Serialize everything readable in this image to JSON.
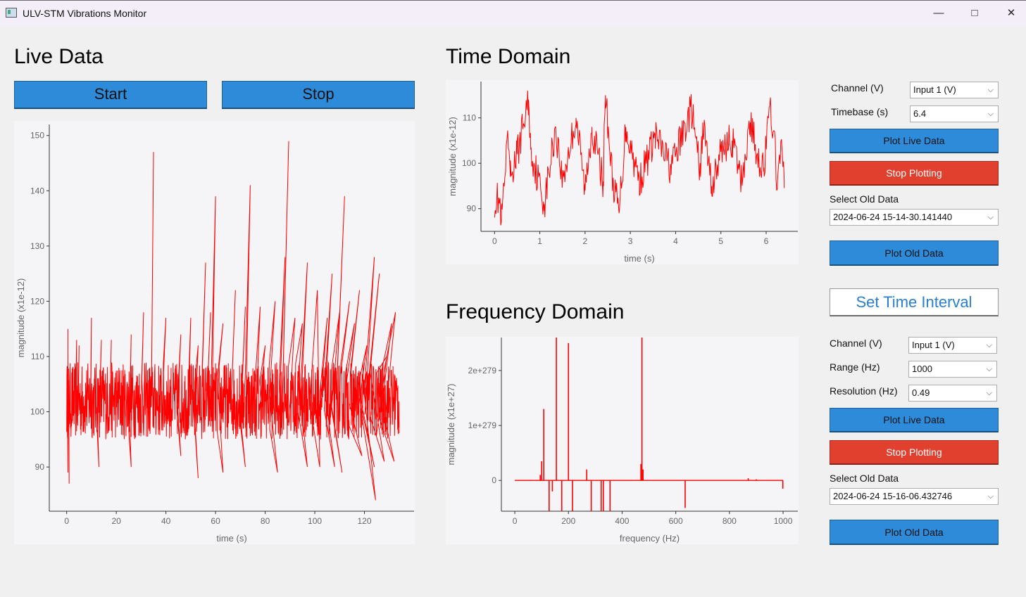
{
  "window": {
    "title": "ULV-STM Vibrations Monitor",
    "minimize": "—",
    "maximize": "□",
    "close": "✕"
  },
  "live": {
    "heading": "Live Data",
    "start_label": "Start",
    "stop_label": "Stop"
  },
  "time_domain": {
    "heading": "Time Domain"
  },
  "frequency_domain": {
    "heading": "Frequency Domain"
  },
  "time_controls": {
    "channel_label": "Channel (V)",
    "channel_value": "Input 1 (V)",
    "timebase_label": "Timebase (s)",
    "timebase_value": "6.4",
    "plot_live_label": "Plot Live Data",
    "stop_plot_label": "Stop Plotting",
    "select_old_label": "Select Old Data",
    "old_data_value": "2024-06-24 15-14-30.141440",
    "plot_old_label": "Plot Old Data"
  },
  "set_interval_label": "Set Time Interval",
  "freq_controls": {
    "channel_label": "Channel (V)",
    "channel_value": "Input 1 (V)",
    "range_label": "Range (Hz)",
    "range_value": "1000",
    "resolution_label": "Resolution (Hz)",
    "resolution_value": "0.49",
    "plot_live_label": "Plot Live Data",
    "stop_plot_label": "Stop Plotting",
    "select_old_label": "Select Old Data",
    "old_data_value": "2024-06-24 15-16-06.432746",
    "plot_old_label": "Plot Old Data"
  },
  "icons": {
    "dropdown": "chevron-down-icon",
    "app": "app-icon"
  },
  "colors": {
    "accent_blue": "#2d8bd9",
    "stop_red": "#e2402f",
    "trace": "#ff0000",
    "plot_bg": "#f5f5f7"
  },
  "chart_data": [
    {
      "type": "line",
      "xlabel": "time (s)",
      "ylabel": "magnitude (x1e-12)",
      "xlim": [
        -7,
        140
      ],
      "ylim": [
        82,
        152
      ],
      "xticks": [
        0,
        20,
        40,
        60,
        80,
        100,
        120
      ],
      "yticks": [
        90,
        100,
        110,
        120,
        130,
        140,
        150
      ],
      "band": {
        "x_start": 0,
        "x_end": 134,
        "center": 102,
        "half_width": 7
      },
      "spikes": [
        [
          0.5,
          115
        ],
        [
          4,
          113
        ],
        [
          5,
          112
        ],
        [
          10,
          117
        ],
        [
          14,
          113
        ],
        [
          18,
          113
        ],
        [
          26,
          114
        ],
        [
          31,
          118
        ],
        [
          35,
          147
        ],
        [
          40,
          117
        ],
        [
          46,
          114
        ],
        [
          50,
          117
        ],
        [
          53,
          112
        ],
        [
          56,
          127
        ],
        [
          58,
          118
        ],
        [
          60,
          139
        ],
        [
          63,
          116
        ],
        [
          68,
          122
        ],
        [
          72,
          119
        ],
        [
          74,
          141
        ],
        [
          78,
          119
        ],
        [
          80,
          112
        ],
        [
          84,
          120
        ],
        [
          88,
          128
        ],
        [
          89.5,
          149
        ],
        [
          92,
          117
        ],
        [
          95,
          116
        ],
        [
          97,
          127
        ],
        [
          101,
          122
        ],
        [
          105,
          117
        ],
        [
          107,
          125
        ],
        [
          110,
          118
        ],
        [
          112,
          139
        ],
        [
          114,
          120
        ],
        [
          116,
          116
        ],
        [
          118,
          122
        ],
        [
          121,
          112
        ],
        [
          124,
          128
        ],
        [
          126,
          125
        ],
        [
          129,
          110
        ],
        [
          131,
          116
        ],
        [
          132.5,
          118
        ]
      ],
      "dips": [
        [
          0.5,
          89
        ],
        [
          1,
          87
        ],
        [
          13,
          90
        ],
        [
          26,
          90
        ],
        [
          46,
          92
        ],
        [
          53,
          88
        ],
        [
          63,
          89
        ],
        [
          72,
          90
        ],
        [
          85,
          89
        ],
        [
          97,
          90
        ],
        [
          102,
          90
        ],
        [
          108,
          90
        ],
        [
          111,
          89
        ],
        [
          119,
          92
        ],
        [
          124,
          90
        ],
        [
          124.5,
          84
        ],
        [
          128,
          91
        ],
        [
          132,
          91
        ]
      ]
    },
    {
      "type": "line",
      "xlabel": "time (s)",
      "ylabel": "magnitude (x1e-12)",
      "xlim": [
        -0.3,
        6.7
      ],
      "ylim": [
        85,
        118
      ],
      "xticks": [
        0,
        1,
        2,
        3,
        4,
        5,
        6
      ],
      "yticks": [
        90,
        100,
        110
      ],
      "x_range": [
        0.0,
        6.4
      ],
      "keypoints": [
        [
          0.1,
          92
        ],
        [
          0.15,
          87
        ],
        [
          0.3,
          105
        ],
        [
          0.35,
          97
        ],
        [
          0.5,
          102
        ],
        [
          0.75,
          114
        ],
        [
          0.8,
          103
        ],
        [
          1.1,
          91
        ],
        [
          1.35,
          108
        ],
        [
          1.5,
          96
        ],
        [
          1.8,
          110
        ],
        [
          2.0,
          94
        ],
        [
          2.15,
          108
        ],
        [
          2.4,
          96
        ],
        [
          2.45,
          115
        ],
        [
          2.6,
          97
        ],
        [
          2.75,
          89
        ],
        [
          2.9,
          108
        ],
        [
          3.2,
          96
        ],
        [
          3.55,
          106
        ],
        [
          3.9,
          99
        ],
        [
          4.35,
          112
        ],
        [
          4.55,
          97
        ],
        [
          4.6,
          109
        ],
        [
          4.8,
          95
        ],
        [
          5.05,
          104
        ],
        [
          5.25,
          105
        ],
        [
          5.45,
          96
        ],
        [
          5.65,
          109
        ],
        [
          5.8,
          102
        ],
        [
          5.95,
          99
        ],
        [
          6.1,
          113
        ],
        [
          6.25,
          96
        ],
        [
          6.35,
          103
        ],
        [
          6.4,
          96
        ]
      ]
    },
    {
      "type": "line",
      "xlabel": "frequency (Hz)",
      "ylabel": "magnitude (x1e+27)",
      "xlim": [
        -50,
        1055
      ],
      "ylim": [
        -5.6e+278,
        2.6e+279
      ],
      "xticks": [
        0,
        200,
        400,
        600,
        800,
        1000
      ],
      "yticks": [
        0,
        1e+279,
        2e+279
      ],
      "ytick_labels": [
        "0",
        "1e+279",
        "1e+279",
        "2e+279"
      ],
      "ytick_display": [
        "0",
        "1e+279",
        "2e+279"
      ],
      "spikes": [
        [
          95,
          1e+278
        ],
        [
          100,
          3.5e+278
        ],
        [
          108,
          1.3e+279
        ],
        [
          128,
          -5.6e+278
        ],
        [
          140,
          -2e+278
        ],
        [
          155,
          2.6e+279
        ],
        [
          175,
          -5.6e+278
        ],
        [
          200,
          2.5e+279
        ],
        [
          215,
          -5.6e+278
        ],
        [
          268,
          2e+278
        ],
        [
          285,
          -5.6e+278
        ],
        [
          322,
          -5.6e+278
        ],
        [
          330,
          -5.6e+278
        ],
        [
          355,
          -5.6e+278
        ],
        [
          470,
          3e+278
        ],
        [
          474,
          2.6e+279
        ],
        [
          478,
          2e+278
        ],
        [
          635,
          -5e+278
        ],
        [
          870,
          4e+277
        ],
        [
          900,
          2e+277
        ],
        [
          999,
          -1.5e+278
        ]
      ]
    }
  ]
}
